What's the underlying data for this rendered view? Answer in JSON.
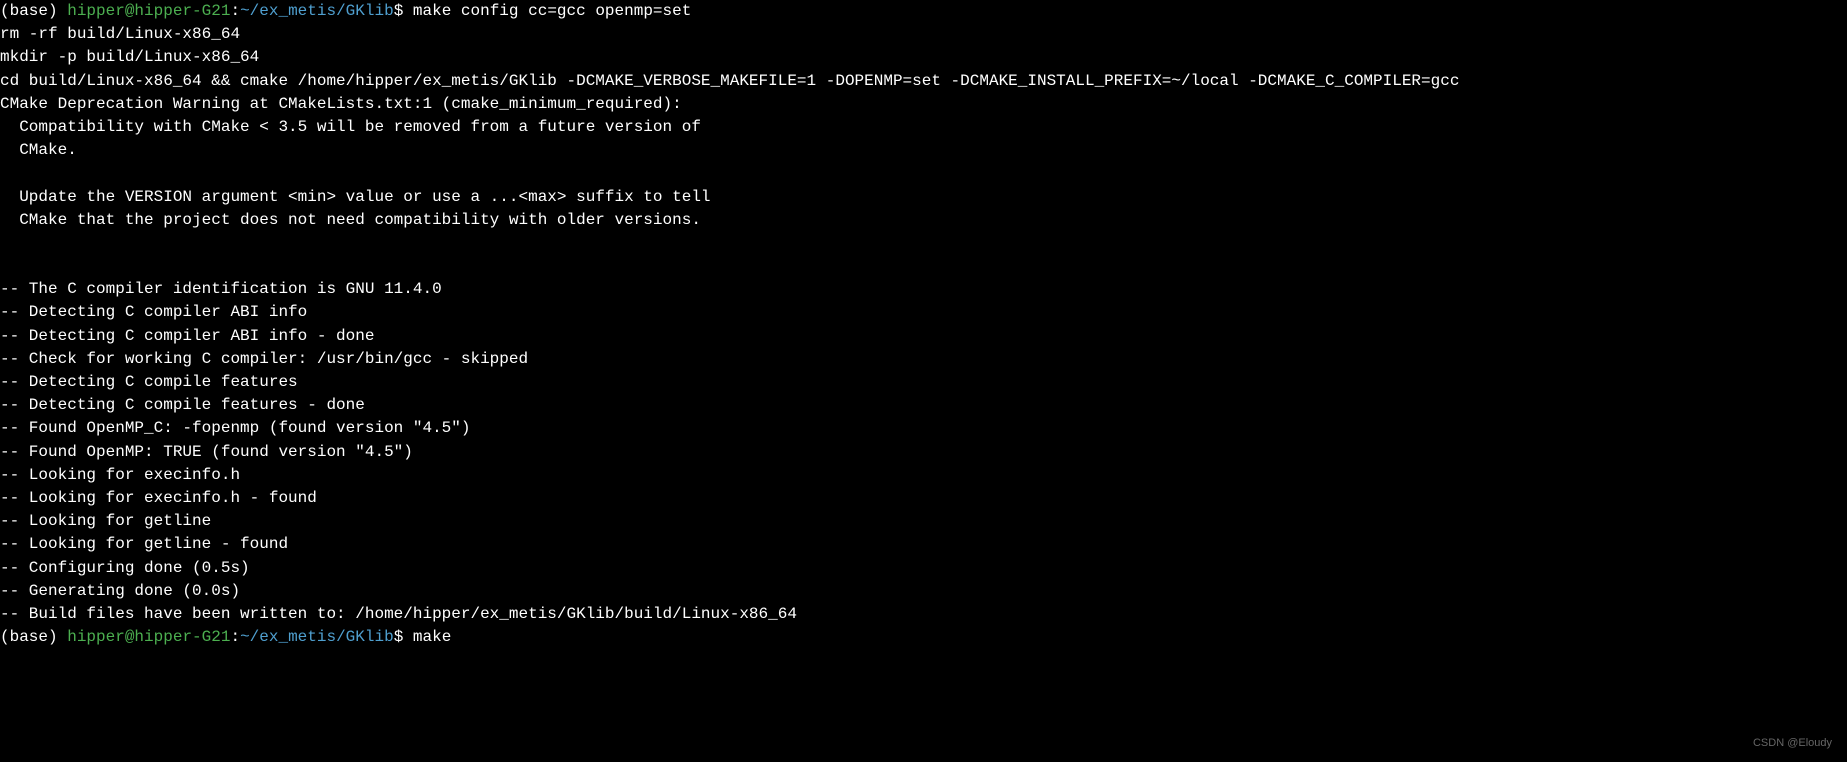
{
  "prompt1": {
    "env": "(base) ",
    "user": "hipper@hipper-G21",
    "sep": ":",
    "path": "~/ex_metis/GKlib",
    "dollar": "$ ",
    "command": "make config cc=gcc openmp=set"
  },
  "output_lines": [
    "rm -rf build/Linux-x86_64",
    "mkdir -p build/Linux-x86_64",
    "cd build/Linux-x86_64 && cmake /home/hipper/ex_metis/GKlib -DCMAKE_VERBOSE_MAKEFILE=1 -DOPENMP=set -DCMAKE_INSTALL_PREFIX=~/local -DCMAKE_C_COMPILER=gcc",
    "CMake Deprecation Warning at CMakeLists.txt:1 (cmake_minimum_required):",
    "  Compatibility with CMake < 3.5 will be removed from a future version of",
    "  CMake.",
    "",
    "  Update the VERSION argument <min> value or use a ...<max> suffix to tell",
    "  CMake that the project does not need compatibility with older versions.",
    "",
    "",
    "-- The C compiler identification is GNU 11.4.0",
    "-- Detecting C compiler ABI info",
    "-- Detecting C compiler ABI info - done",
    "-- Check for working C compiler: /usr/bin/gcc - skipped",
    "-- Detecting C compile features",
    "-- Detecting C compile features - done",
    "-- Found OpenMP_C: -fopenmp (found version \"4.5\")",
    "-- Found OpenMP: TRUE (found version \"4.5\")",
    "-- Looking for execinfo.h",
    "-- Looking for execinfo.h - found",
    "-- Looking for getline",
    "-- Looking for getline - found",
    "-- Configuring done (0.5s)",
    "-- Generating done (0.0s)",
    "-- Build files have been written to: /home/hipper/ex_metis/GKlib/build/Linux-x86_64"
  ],
  "prompt2": {
    "env": "(base) ",
    "user": "hipper@hipper-G21",
    "sep": ":",
    "path": "~/ex_metis/GKlib",
    "dollar": "$ ",
    "command": "make"
  },
  "watermark": "CSDN @Eloudy"
}
